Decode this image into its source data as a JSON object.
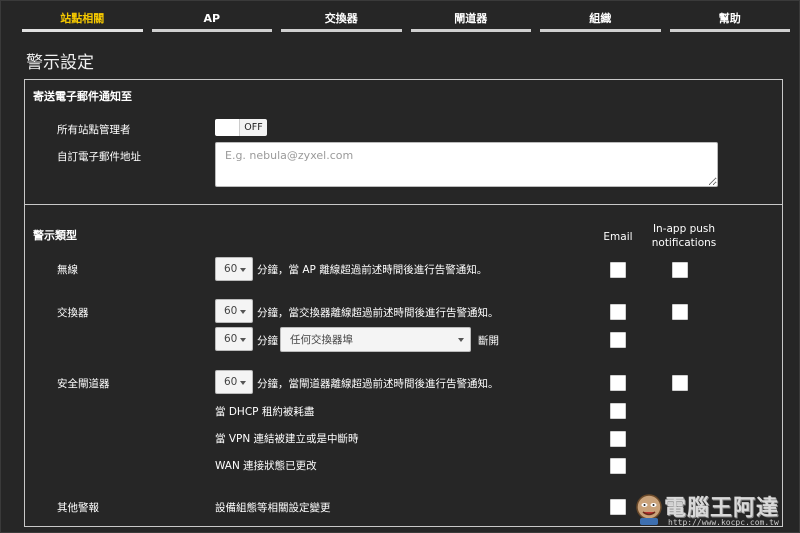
{
  "tabs": [
    "站點相關",
    "AP",
    "交換器",
    "閘道器",
    "組織",
    "幫助"
  ],
  "page_title": "警示設定",
  "email_section": {
    "title": "寄送電子郵件通知至",
    "all_admins_label": "所有站點管理者",
    "toggle_state": "OFF",
    "custom_email_label": "自訂電子郵件地址",
    "email_placeholder": "E.g. nebula@zyxel.com"
  },
  "alert_section": {
    "title": "警示類型",
    "col_email": "Email",
    "col_inapp_line1": "In-app push",
    "col_inapp_line2": "notifications"
  },
  "rows": {
    "wireless_label": "無線",
    "wireless_minutes": "60",
    "wireless_text": "分鐘，當 AP 離線超過前述時間後進行告警通知。",
    "switch_label": "交換器",
    "switch_minutes": "60",
    "switch_text": "分鐘，當交換器離線超過前述時間後進行告警通知。",
    "switch_port_minutes": "60",
    "switch_port_unit": "分鐘",
    "switch_port_select": "任何交換器埠",
    "switch_port_suffix": "斷開",
    "gateway_label": "安全閘道器",
    "gateway_minutes": "60",
    "gateway_text": "分鐘，當閘道器離線超過前述時間後進行告警通知。",
    "dhcp_text": "當 DHCP 租約被耗盡",
    "vpn_text": "當 VPN 連結被建立或是中斷時",
    "wan_text": "WAN 連接狀態已更改",
    "other_label": "其他警報",
    "other_text": "設備組態等相關設定變更"
  },
  "watermark": {
    "text": "電腦王阿達",
    "url": "http://www.kocpc.com.tw"
  },
  "colors": {
    "background": "#262626",
    "active_tab": "#f5c800",
    "panel_border": "#c8c8c8"
  }
}
